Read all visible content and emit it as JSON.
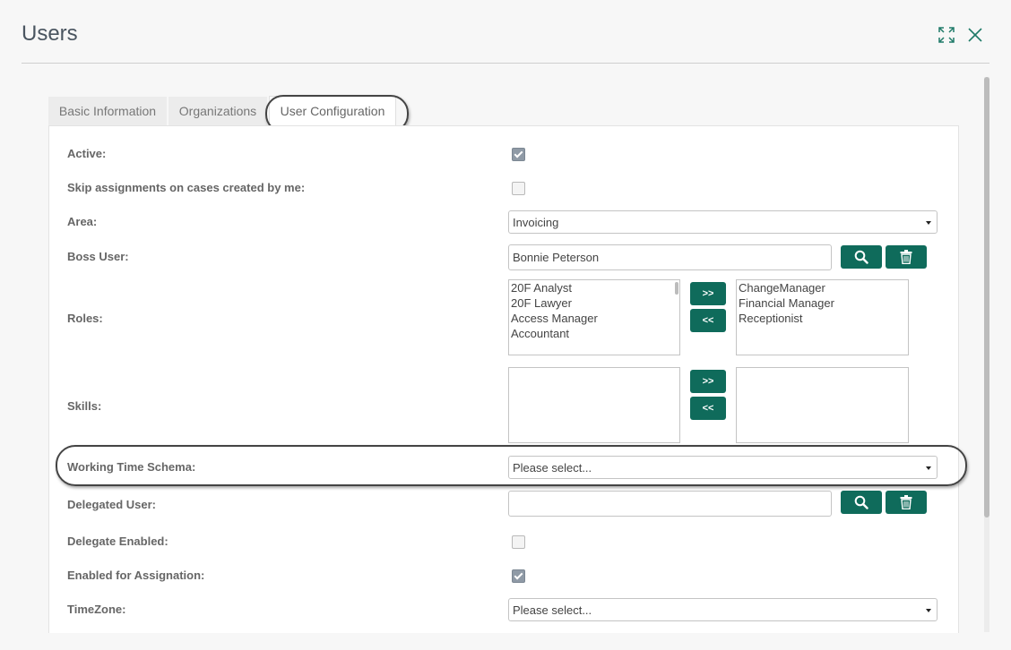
{
  "dialog": {
    "title": "Users",
    "expand_icon": "expand-icon",
    "close_icon": "close-icon"
  },
  "tabs": [
    {
      "label": "Basic Information",
      "active": false
    },
    {
      "label": "Organizations",
      "active": false
    },
    {
      "label": "User Configuration",
      "active": true
    }
  ],
  "form": {
    "active": {
      "label": "Active:",
      "checked": true
    },
    "skip_assignments": {
      "label": "Skip assignments on cases created by me:",
      "checked": false
    },
    "area": {
      "label": "Area:",
      "value": "Invoicing"
    },
    "boss_user": {
      "label": "Boss User:",
      "value": "Bonnie Peterson"
    },
    "roles": {
      "label": "Roles:",
      "available": [
        "20F Analyst",
        "20F Lawyer",
        "Access Manager",
        "Accountant"
      ],
      "selected": [
        "ChangeManager",
        "Financial Manager",
        "Receptionist"
      ]
    },
    "skills": {
      "label": "Skills:",
      "available": [],
      "selected": []
    },
    "move_right_label": ">>",
    "move_left_label": "<<",
    "working_time_schema": {
      "label": "Working Time Schema:",
      "value": "Please select..."
    },
    "delegated_user": {
      "label": "Delegated User:",
      "value": ""
    },
    "delegate_enabled": {
      "label": "Delegate Enabled:",
      "checked": false
    },
    "enabled_for_assignation": {
      "label": "Enabled for Assignation:",
      "checked": true
    },
    "timezone": {
      "label": "TimeZone:",
      "value": "Please select..."
    }
  },
  "colors": {
    "accent": "#0f6b5b",
    "checked": "#8f9aa6"
  }
}
